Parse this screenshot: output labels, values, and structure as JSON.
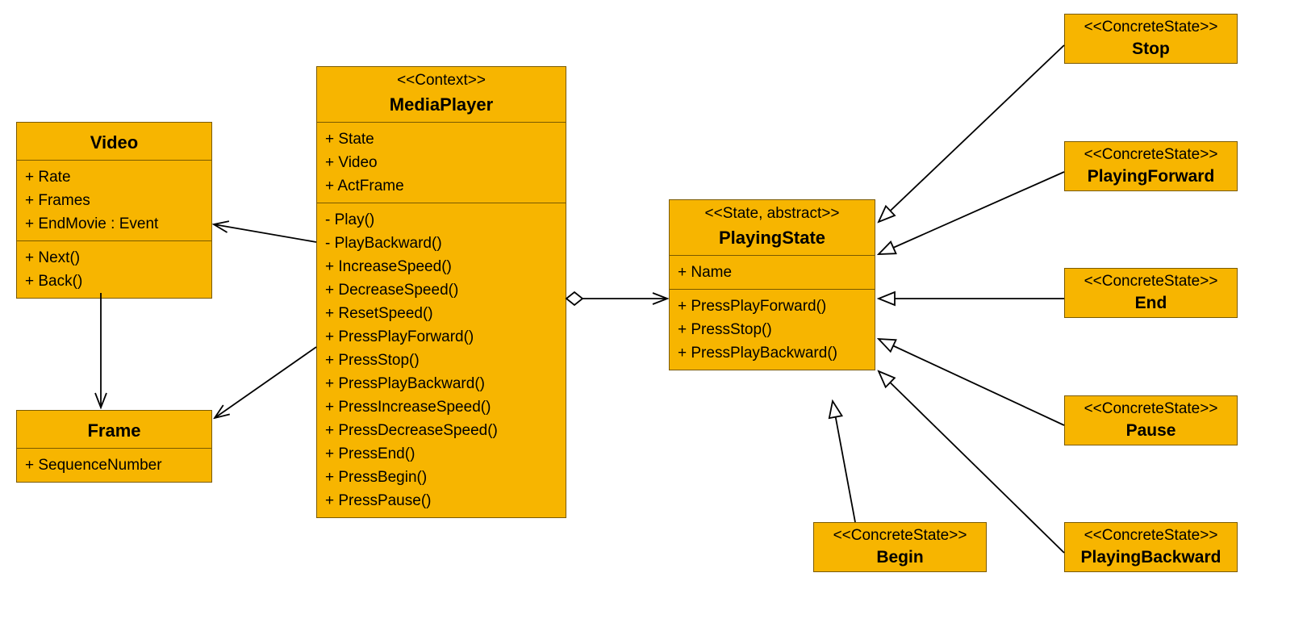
{
  "colors": {
    "fill": "#F7B500",
    "border": "#7a5a00"
  },
  "classes": {
    "video": {
      "stereotype": "",
      "name": "Video",
      "attrs": [
        "+ Rate",
        "+ Frames",
        "+ EndMovie : Event"
      ],
      "ops": [
        "+ Next()",
        "+ Back()"
      ]
    },
    "frame": {
      "stereotype": "",
      "name": "Frame",
      "attrs": [
        "+ SequenceNumber"
      ],
      "ops": []
    },
    "mediaplayer": {
      "stereotype": "<<Context>>",
      "name": "MediaPlayer",
      "attrs": [
        "+ State",
        "+ Video",
        "+ ActFrame"
      ],
      "ops": [
        "- Play()",
        "- PlayBackward()",
        "+ IncreaseSpeed()",
        "+ DecreaseSpeed()",
        "+ ResetSpeed()",
        "+ PressPlayForward()",
        "+ PressStop()",
        "+ PressPlayBackward()",
        "+ PressIncreaseSpeed()",
        "+ PressDecreaseSpeed()",
        "+ PressEnd()",
        "+ PressBegin()",
        "+ PressPause()"
      ]
    },
    "playingstate": {
      "stereotype": "<<State, abstract>>",
      "name": "PlayingState",
      "attrs": [
        "+ Name"
      ],
      "ops": [
        "+ PressPlayForward()",
        "+ PressStop()",
        "+ PressPlayBackward()"
      ]
    },
    "stop": {
      "stereotype": "<<ConcreteState>>",
      "name": "Stop"
    },
    "playingforward": {
      "stereotype": "<<ConcreteState>>",
      "name": "PlayingForward"
    },
    "end": {
      "stereotype": "<<ConcreteState>>",
      "name": "End"
    },
    "pause": {
      "stereotype": "<<ConcreteState>>",
      "name": "Pause"
    },
    "playingbackward": {
      "stereotype": "<<ConcreteState>>",
      "name": "PlayingBackward"
    },
    "begin": {
      "stereotype": "<<ConcreteState>>",
      "name": "Begin"
    }
  },
  "relations": [
    {
      "from": "MediaPlayer",
      "to": "Video",
      "type": "association-nav"
    },
    {
      "from": "MediaPlayer",
      "to": "Frame",
      "type": "association-nav"
    },
    {
      "from": "Video",
      "to": "Frame",
      "type": "association-nav"
    },
    {
      "from": "MediaPlayer",
      "to": "PlayingState",
      "type": "aggregation-nav"
    },
    {
      "from": "Stop",
      "to": "PlayingState",
      "type": "generalization"
    },
    {
      "from": "PlayingForward",
      "to": "PlayingState",
      "type": "generalization"
    },
    {
      "from": "End",
      "to": "PlayingState",
      "type": "generalization"
    },
    {
      "from": "Pause",
      "to": "PlayingState",
      "type": "generalization"
    },
    {
      "from": "PlayingBackward",
      "to": "PlayingState",
      "type": "generalization"
    },
    {
      "from": "Begin",
      "to": "PlayingState",
      "type": "generalization"
    }
  ]
}
